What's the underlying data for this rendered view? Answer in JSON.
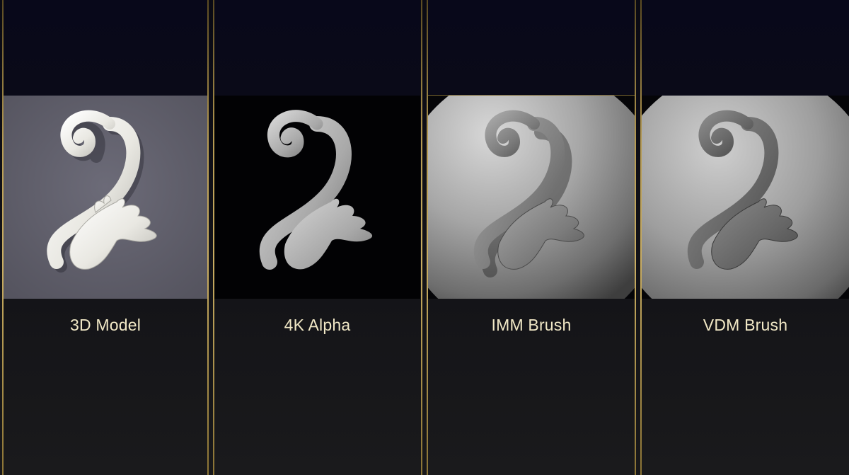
{
  "panels": [
    {
      "label": "3D Model",
      "preview": "scroll-ornament-on-gray-backdrop"
    },
    {
      "label": "4K Alpha",
      "preview": "scroll-ornament-heightmap-on-black"
    },
    {
      "label": "IMM Brush",
      "preview": "scroll-ornament-on-sphere"
    },
    {
      "label": "VDM Brush",
      "preview": "scroll-ornament-sculpted-on-sphere"
    }
  ],
  "colors": {
    "label_text": "#f1e8c6",
    "divider_gold": "#c9ad62",
    "background": "#141416"
  }
}
